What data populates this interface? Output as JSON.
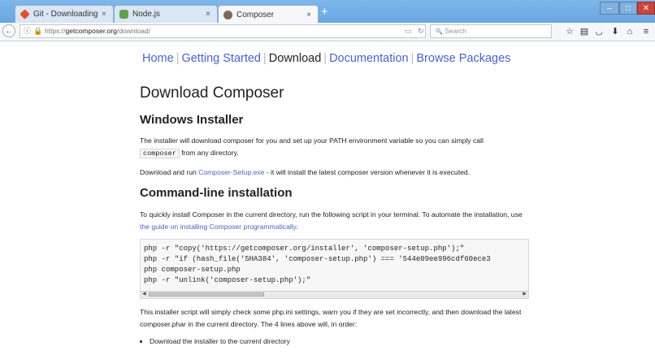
{
  "browser": {
    "tabs": [
      {
        "label": "Git - Downloading Package",
        "icon": "git-favicon",
        "active": false
      },
      {
        "label": "Node.js",
        "icon": "nodejs-favicon",
        "active": false
      },
      {
        "label": "Composer",
        "icon": "composer-favicon",
        "active": true
      }
    ],
    "url_prefix": "https://",
    "url_domain": "getcomposer.org",
    "url_path": "/download/",
    "search_placeholder": "Search",
    "glyphs": {
      "tab_close": "×",
      "new_tab": "+",
      "back": "←",
      "info": "ⓘ",
      "lock": "🔒",
      "reader": "▭",
      "reload": "↻",
      "search": "🔍",
      "bookmark": "☆",
      "library": "▤",
      "pocket": "◡",
      "download": "⬇",
      "home": "⌂",
      "menu": "≡",
      "minimize": "–",
      "maximize": "□",
      "close": "✕"
    }
  },
  "page": {
    "nav": [
      {
        "label": "Home",
        "current": false
      },
      {
        "label": "Getting Started",
        "current": false
      },
      {
        "label": "Download",
        "current": true
      },
      {
        "label": "Documentation",
        "current": false
      },
      {
        "label": "Browse Packages",
        "current": false
      }
    ],
    "title": "Download Composer",
    "windows": {
      "heading": "Windows Installer",
      "p1_a": "The installer will download composer for you and set up your PATH environment variable so you can simply call",
      "p1_code": "composer",
      "p1_b": "from any directory.",
      "p2_a": "Download and run",
      "p2_link": "Composer-Setup.exe",
      "p2_b": "- it will install the latest composer version whenever it is executed."
    },
    "cli": {
      "heading": "Command-line installation",
      "p_a": "To quickly install Composer in the current directory, run the following script in your terminal. To automate the installation, use",
      "p_link": "the guide on installing Composer programmatically",
      "p_b": ".",
      "code": [
        "php -r \"copy('https://getcomposer.org/installer', 'composer-setup.php');\"",
        "php -r \"if (hash_file('SHA384', 'composer-setup.php') === '544e09ee996cdf60ece3",
        "php composer-setup.php",
        "php -r \"unlink('composer-setup.php');\""
      ],
      "after": "This installer script will simply check some php.ini settings, warn you if they are set incorrectly, and then download the latest composer.phar in the current directory. The 4 lines above will, in order:",
      "steps": [
        "Download the installer to the current directory"
      ]
    }
  }
}
